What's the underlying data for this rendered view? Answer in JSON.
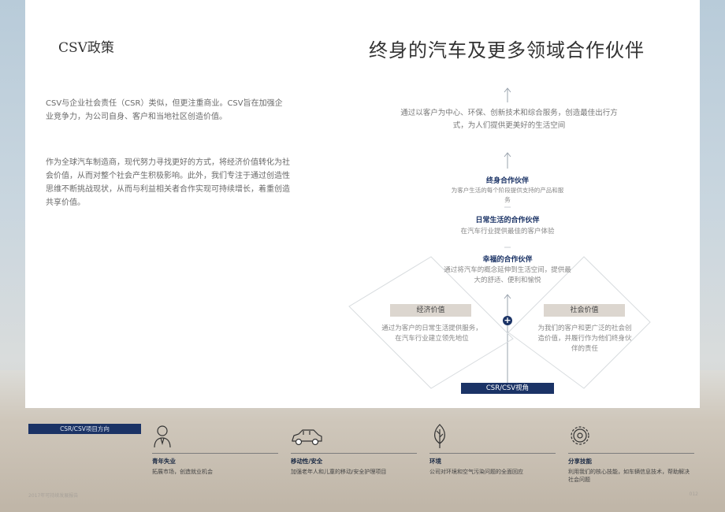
{
  "left": {
    "heading": "CSV政策",
    "paragraph1": "CSV与企业社会责任（CSR）类似，但更注重商业。CSV旨在加强企业竞争力，为公司自身、客户和当地社区创造价值。",
    "paragraph2": "作为全球汽车制造商，现代努力寻找更好的方式，将经济价值转化为社会价值，从而对整个社会产生积极影响。此外，我们专注于通过创造性思维不断挑战现状，从而与利益相关者合作实现可持续增长，着重创造共享价值。"
  },
  "diagram": {
    "title": "终身的汽车及更多领域合作伙伴",
    "intro": "通过以客户为中心、环保、创新技术和综合服务，创造最佳出行方式，为人们提供更美好的生活空间",
    "sections": [
      {
        "title": "终身合作伙伴",
        "desc": "为客户生活的每个阶段提供支持的产品和服务"
      },
      {
        "title": "日常生活的合作伙伴",
        "desc": "在汽车行业提供最佳的客户体验"
      },
      {
        "title": "幸福的合作伙伴",
        "desc": "通过将汽车的概念延伸到生活空间，提供最大的舒适、便利和愉悦"
      }
    ],
    "economic": {
      "label": "经济价值",
      "desc": "通过为客户的日常生活提供服务，在汽车行业建立领先地位"
    },
    "social": {
      "label": "社会价值",
      "desc": "为我们的客户和更广泛的社会创造价值，并履行作为他们终身伙伴的责任"
    },
    "plus": "+",
    "view_label": "CSR/CSV视角"
  },
  "direction_label": "CSR/CSV项目方向",
  "categories": [
    {
      "icon": "person-icon",
      "title": "青年失业",
      "desc": "拓展市场，创造就业机会"
    },
    {
      "icon": "car-icon",
      "title": "移动性/安全",
      "desc": "加强老年人和儿童的移动/安全护理项目"
    },
    {
      "icon": "leaf-icon",
      "title": "环境",
      "desc": "公司对环境和空气污染问题的全面回应"
    },
    {
      "icon": "gear-icon",
      "title": "分享技能",
      "desc": "利用我们的核心技能，如车辆信息技术，帮助解决社会问题"
    }
  ],
  "footer": {
    "left": "2017年可持续发展报告",
    "right": "012"
  },
  "colors": {
    "navy": "#1b3366",
    "label_bg": "#dcd6cf"
  }
}
